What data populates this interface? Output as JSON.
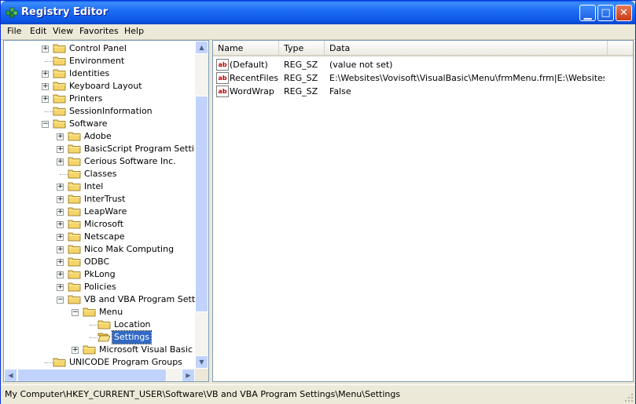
{
  "window": {
    "title": "Registry Editor"
  },
  "menu": [
    "File",
    "Edit",
    "View",
    "Favorites",
    "Help"
  ],
  "tree": [
    {
      "label": "Control Panel",
      "level": 0,
      "expander": "+"
    },
    {
      "label": "Environment",
      "level": 0,
      "expander": ""
    },
    {
      "label": "Identities",
      "level": 0,
      "expander": "+"
    },
    {
      "label": "Keyboard Layout",
      "level": 0,
      "expander": "+"
    },
    {
      "label": "Printers",
      "level": 0,
      "expander": "+"
    },
    {
      "label": "SessionInformation",
      "level": 0,
      "expander": ""
    },
    {
      "label": "Software",
      "level": 0,
      "expander": "−",
      "open": true
    },
    {
      "label": "Adobe",
      "level": 1,
      "expander": "+"
    },
    {
      "label": "BasicScript Program Settings",
      "level": 1,
      "expander": "+"
    },
    {
      "label": "Cerious Software Inc.",
      "level": 1,
      "expander": "+"
    },
    {
      "label": "Classes",
      "level": 1,
      "expander": ""
    },
    {
      "label": "Intel",
      "level": 1,
      "expander": "+"
    },
    {
      "label": "InterTrust",
      "level": 1,
      "expander": "+"
    },
    {
      "label": "LeapWare",
      "level": 1,
      "expander": "+"
    },
    {
      "label": "Microsoft",
      "level": 1,
      "expander": "+"
    },
    {
      "label": "Netscape",
      "level": 1,
      "expander": "+"
    },
    {
      "label": "Nico Mak Computing",
      "level": 1,
      "expander": "+"
    },
    {
      "label": "ODBC",
      "level": 1,
      "expander": "+"
    },
    {
      "label": "PkLong",
      "level": 1,
      "expander": "+"
    },
    {
      "label": "Policies",
      "level": 1,
      "expander": "+"
    },
    {
      "label": "VB and VBA Program Settings",
      "level": 1,
      "expander": "−",
      "open": true
    },
    {
      "label": "Menu",
      "level": 2,
      "expander": "−",
      "open": true
    },
    {
      "label": "Location",
      "level": 3,
      "expander": ""
    },
    {
      "label": "Settings",
      "level": 3,
      "expander": "",
      "selected": true,
      "open": true
    },
    {
      "label": "Microsoft Visual Basic Add",
      "level": 2,
      "expander": "+"
    },
    {
      "label": "UNICODE Program Groups",
      "level": 0,
      "expander": ""
    }
  ],
  "list": {
    "columns": [
      "Name",
      "Type",
      "Data"
    ],
    "rows": [
      {
        "name": "(Default)",
        "type": "REG_SZ",
        "data": "(value not set)"
      },
      {
        "name": "RecentFiles",
        "type": "REG_SZ",
        "data": "E:\\Websites\\Vovisoft\\VisualBasic\\Menu\\frmMenu.frm|E:\\Websites\\Vov..."
      },
      {
        "name": "WordWrap",
        "type": "REG_SZ",
        "data": "False"
      }
    ]
  },
  "status": {
    "path": "My Computer\\HKEY_CURRENT_USER\\Software\\VB and VBA Program Settings\\Menu\\Settings"
  },
  "colors": {
    "titlebar": "#0A5EE8",
    "selection": "#316AC5",
    "folder": "#F5D56A"
  }
}
